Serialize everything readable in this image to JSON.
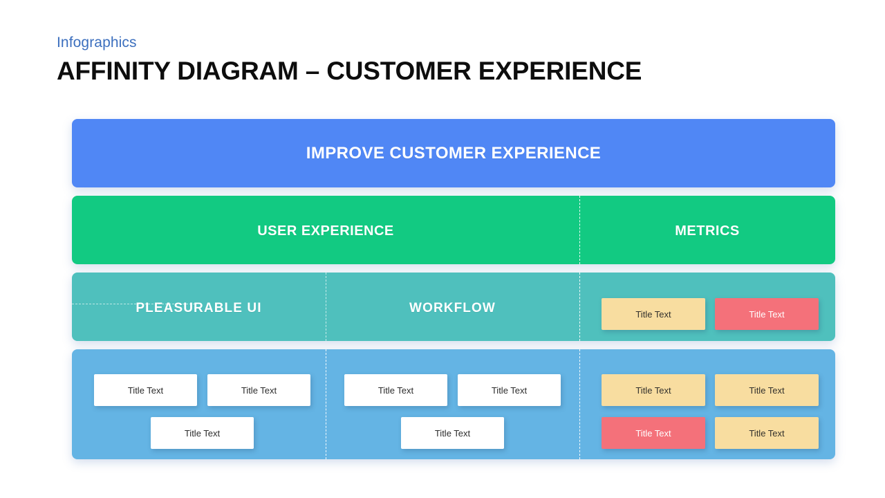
{
  "header": {
    "eyebrow": "Infographics",
    "title": "AFFINITY DIAGRAM – CUSTOMER EXPERIENCE"
  },
  "colors": {
    "accent_blue": "#3c6fbe",
    "goal_band": "#5087f5",
    "theme_band": "#12ca82",
    "subtheme_band": "#4fc0bd",
    "note_band": "#64b4e4",
    "card_white": "#ffffff",
    "card_yellow": "#f8dda0",
    "card_red": "#f4717a",
    "page_background": "#ffffff"
  },
  "diagram": {
    "goal": {
      "label": "IMPROVE CUSTOMER EXPERIENCE"
    },
    "themes": [
      {
        "label": "USER EXPERIENCE"
      },
      {
        "label": "METRICS"
      }
    ],
    "subthemes": [
      {
        "label": "PLEASURABLE UI"
      },
      {
        "label": "WORKFLOW"
      }
    ],
    "metrics_cards": [
      {
        "label": "Title Text",
        "color": "yellow"
      },
      {
        "label": "Title Text",
        "color": "red"
      }
    ],
    "notes": {
      "pleasurable_ui": [
        {
          "label": "Title Text",
          "color": "white"
        },
        {
          "label": "Title Text",
          "color": "white"
        },
        {
          "label": "Title Text",
          "color": "white"
        }
      ],
      "workflow": [
        {
          "label": "Title Text",
          "color": "white"
        },
        {
          "label": "Title Text",
          "color": "white"
        },
        {
          "label": "Title Text",
          "color": "white"
        }
      ],
      "metrics": [
        {
          "label": "Title Text",
          "color": "yellow"
        },
        {
          "label": "Title Text",
          "color": "yellow"
        },
        {
          "label": "Title Text",
          "color": "red"
        },
        {
          "label": "Title Text",
          "color": "yellow"
        }
      ]
    }
  }
}
